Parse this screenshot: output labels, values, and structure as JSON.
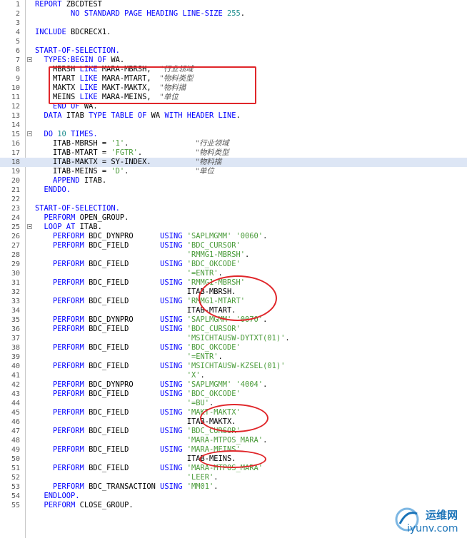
{
  "editor": {
    "highlight_line": 18,
    "fold_lines": [
      7,
      15,
      25
    ],
    "lines": [
      {
        "n": "1",
        "tokens": [
          [
            "kw",
            "REPORT "
          ],
          [
            "id",
            "ZBCDTEST"
          ]
        ]
      },
      {
        "n": "2",
        "tokens": [
          [
            "kw",
            "        NO STANDARD PAGE HEADING LINE-SIZE "
          ],
          [
            "num",
            "255"
          ],
          [
            "id",
            "."
          ]
        ]
      },
      {
        "n": "3",
        "tokens": []
      },
      {
        "n": "4",
        "tokens": [
          [
            "kw",
            "INCLUDE "
          ],
          [
            "id",
            "BDCRECX1."
          ]
        ]
      },
      {
        "n": "5",
        "tokens": []
      },
      {
        "n": "6",
        "tokens": [
          [
            "kw",
            "START-OF-SELECTION."
          ]
        ]
      },
      {
        "n": "7",
        "tokens": [
          [
            "kw",
            "  TYPES:BEGIN OF "
          ],
          [
            "id",
            "WA."
          ]
        ]
      },
      {
        "n": "8",
        "tokens": [
          [
            "id",
            "    MBRSH "
          ],
          [
            "kw",
            "LIKE "
          ],
          [
            "id",
            "MARA-MBRSH,  "
          ],
          [
            "cmt",
            "\"行业领域"
          ]
        ]
      },
      {
        "n": "9",
        "tokens": [
          [
            "id",
            "    MTART "
          ],
          [
            "kw",
            "LIKE "
          ],
          [
            "id",
            "MARA-MTART,  "
          ],
          [
            "cmt",
            "\"物料类型"
          ]
        ]
      },
      {
        "n": "10",
        "tokens": [
          [
            "id",
            "    MAKTX "
          ],
          [
            "kw",
            "LIKE "
          ],
          [
            "id",
            "MAKT-MAKTX,  "
          ],
          [
            "cmt",
            "\"物料描"
          ]
        ]
      },
      {
        "n": "11",
        "tokens": [
          [
            "id",
            "    MEINS "
          ],
          [
            "kw",
            "LIKE "
          ],
          [
            "id",
            "MARA-MEINS,  "
          ],
          [
            "cmt",
            "\"单位"
          ]
        ]
      },
      {
        "n": "12",
        "tokens": [
          [
            "kw",
            "    END OF "
          ],
          [
            "id",
            "WA."
          ]
        ]
      },
      {
        "n": "13",
        "tokens": [
          [
            "kw",
            "  DATA "
          ],
          [
            "id",
            "ITAB "
          ],
          [
            "kw",
            "TYPE TABLE OF "
          ],
          [
            "id",
            "WA "
          ],
          [
            "kw",
            "WITH HEADER LINE"
          ],
          [
            "id",
            "."
          ]
        ]
      },
      {
        "n": "14",
        "tokens": []
      },
      {
        "n": "15",
        "tokens": [
          [
            "kw",
            "  DO "
          ],
          [
            "num",
            "10"
          ],
          [
            "kw",
            " TIMES."
          ]
        ]
      },
      {
        "n": "16",
        "tokens": [
          [
            "id",
            "    ITAB-MBRSH = "
          ],
          [
            "str",
            "'1'"
          ],
          [
            "id",
            "."
          ],
          [
            "id",
            "               "
          ],
          [
            "cmt",
            "\"行业领域"
          ]
        ]
      },
      {
        "n": "17",
        "tokens": [
          [
            "id",
            "    ITAB-MTART = "
          ],
          [
            "str",
            "'FGTR'"
          ],
          [
            "id",
            "."
          ],
          [
            "id",
            "            "
          ],
          [
            "cmt",
            "\"物料类型"
          ]
        ]
      },
      {
        "n": "18",
        "tokens": [
          [
            "id",
            "    ITAB-MAKTX = SY-INDEX."
          ],
          [
            "id",
            "          "
          ],
          [
            "cmt",
            "\"物料描"
          ]
        ]
      },
      {
        "n": "19",
        "tokens": [
          [
            "id",
            "    ITAB-MEINS = "
          ],
          [
            "str",
            "'D'"
          ],
          [
            "id",
            "."
          ],
          [
            "id",
            "               "
          ],
          [
            "cmt",
            "\"单位"
          ]
        ]
      },
      {
        "n": "20",
        "tokens": [
          [
            "kw",
            "    APPEND "
          ],
          [
            "id",
            "ITAB."
          ]
        ]
      },
      {
        "n": "21",
        "tokens": [
          [
            "kw",
            "  ENDDO."
          ]
        ]
      },
      {
        "n": "22",
        "tokens": []
      },
      {
        "n": "23",
        "tokens": [
          [
            "kw",
            "START-OF-SELECTION."
          ]
        ]
      },
      {
        "n": "24",
        "tokens": [
          [
            "kw",
            "  PERFORM "
          ],
          [
            "id",
            "OPEN_GROUP."
          ]
        ]
      },
      {
        "n": "25",
        "tokens": [
          [
            "kw",
            "  LOOP AT "
          ],
          [
            "id",
            "ITAB."
          ]
        ]
      },
      {
        "n": "26",
        "tokens": [
          [
            "kw",
            "    PERFORM "
          ],
          [
            "id",
            "BDC_DYNPRO      "
          ],
          [
            "kw",
            "USING "
          ],
          [
            "str",
            "'SAPLMGMM' '0060'"
          ],
          [
            "id",
            "."
          ]
        ]
      },
      {
        "n": "27",
        "tokens": [
          [
            "kw",
            "    PERFORM "
          ],
          [
            "id",
            "BDC_FIELD       "
          ],
          [
            "kw",
            "USING "
          ],
          [
            "str",
            "'BDC_CURSOR'"
          ]
        ]
      },
      {
        "n": "28",
        "tokens": [
          [
            "id",
            "                                  "
          ],
          [
            "str",
            "'RMMG1-MBRSH'"
          ],
          [
            "id",
            "."
          ]
        ]
      },
      {
        "n": "29",
        "tokens": [
          [
            "kw",
            "    PERFORM "
          ],
          [
            "id",
            "BDC_FIELD       "
          ],
          [
            "kw",
            "USING "
          ],
          [
            "str",
            "'BDC_OKCODE'"
          ]
        ]
      },
      {
        "n": "30",
        "tokens": [
          [
            "id",
            "                                  "
          ],
          [
            "str",
            "'=ENTR'"
          ],
          [
            "id",
            "."
          ]
        ]
      },
      {
        "n": "31",
        "tokens": [
          [
            "kw",
            "    PERFORM "
          ],
          [
            "id",
            "BDC_FIELD       "
          ],
          [
            "kw",
            "USING "
          ],
          [
            "str",
            "'RMMG1-MBRSH'"
          ]
        ]
      },
      {
        "n": "32",
        "tokens": [
          [
            "id",
            "                                  ITAB-MBRSH."
          ]
        ]
      },
      {
        "n": "33",
        "tokens": [
          [
            "kw",
            "    PERFORM "
          ],
          [
            "id",
            "BDC_FIELD       "
          ],
          [
            "kw",
            "USING "
          ],
          [
            "str",
            "'RMMG1-MTART'"
          ]
        ]
      },
      {
        "n": "34",
        "tokens": [
          [
            "id",
            "                                  ITAB-MTART."
          ]
        ]
      },
      {
        "n": "35",
        "tokens": [
          [
            "kw",
            "    PERFORM "
          ],
          [
            "id",
            "BDC_DYNPRO      "
          ],
          [
            "kw",
            "USING "
          ],
          [
            "str",
            "'SAPLMGMM' '0070'"
          ],
          [
            "id",
            "."
          ]
        ]
      },
      {
        "n": "36",
        "tokens": [
          [
            "kw",
            "    PERFORM "
          ],
          [
            "id",
            "BDC_FIELD       "
          ],
          [
            "kw",
            "USING "
          ],
          [
            "str",
            "'BDC_CURSOR'"
          ]
        ]
      },
      {
        "n": "37",
        "tokens": [
          [
            "id",
            "                                  "
          ],
          [
            "str",
            "'MSICHTAUSW-DYTXT(01)'"
          ],
          [
            "id",
            "."
          ]
        ]
      },
      {
        "n": "38",
        "tokens": [
          [
            "kw",
            "    PERFORM "
          ],
          [
            "id",
            "BDC_FIELD       "
          ],
          [
            "kw",
            "USING "
          ],
          [
            "str",
            "'BDC_OKCODE'"
          ]
        ]
      },
      {
        "n": "39",
        "tokens": [
          [
            "id",
            "                                  "
          ],
          [
            "str",
            "'=ENTR'"
          ],
          [
            "id",
            "."
          ]
        ]
      },
      {
        "n": "40",
        "tokens": [
          [
            "kw",
            "    PERFORM "
          ],
          [
            "id",
            "BDC_FIELD       "
          ],
          [
            "kw",
            "USING "
          ],
          [
            "str",
            "'MSICHTAUSW-KZSEL(01)'"
          ]
        ]
      },
      {
        "n": "41",
        "tokens": [
          [
            "id",
            "                                  "
          ],
          [
            "str",
            "'X'"
          ],
          [
            "id",
            "."
          ]
        ]
      },
      {
        "n": "42",
        "tokens": [
          [
            "kw",
            "    PERFORM "
          ],
          [
            "id",
            "BDC_DYNPRO      "
          ],
          [
            "kw",
            "USING "
          ],
          [
            "str",
            "'SAPLMGMM' '4004'"
          ],
          [
            "id",
            "."
          ]
        ]
      },
      {
        "n": "43",
        "tokens": [
          [
            "kw",
            "    PERFORM "
          ],
          [
            "id",
            "BDC_FIELD       "
          ],
          [
            "kw",
            "USING "
          ],
          [
            "str",
            "'BDC_OKCODE'"
          ]
        ]
      },
      {
        "n": "44",
        "tokens": [
          [
            "id",
            "                                  "
          ],
          [
            "str",
            "'=BU'"
          ],
          [
            "id",
            "."
          ]
        ]
      },
      {
        "n": "45",
        "tokens": [
          [
            "kw",
            "    PERFORM "
          ],
          [
            "id",
            "BDC_FIELD       "
          ],
          [
            "kw",
            "USING "
          ],
          [
            "str",
            "'MAKT-MAKTX'"
          ]
        ]
      },
      {
        "n": "46",
        "tokens": [
          [
            "id",
            "                                  ITAB-MAKTX."
          ]
        ]
      },
      {
        "n": "47",
        "tokens": [
          [
            "kw",
            "    PERFORM "
          ],
          [
            "id",
            "BDC_FIELD       "
          ],
          [
            "kw",
            "USING "
          ],
          [
            "str",
            "'BDC_CURSOR'"
          ]
        ]
      },
      {
        "n": "48",
        "tokens": [
          [
            "id",
            "                                  "
          ],
          [
            "str",
            "'MARA-MTPOS_MARA'"
          ],
          [
            "id",
            "."
          ]
        ]
      },
      {
        "n": "49",
        "tokens": [
          [
            "kw",
            "    PERFORM "
          ],
          [
            "id",
            "BDC_FIELD       "
          ],
          [
            "kw",
            "USING "
          ],
          [
            "str",
            "'MARA-MEINS'"
          ]
        ]
      },
      {
        "n": "50",
        "tokens": [
          [
            "id",
            "                                  ITAB-MEINS."
          ]
        ]
      },
      {
        "n": "51",
        "tokens": [
          [
            "kw",
            "    PERFORM "
          ],
          [
            "id",
            "BDC_FIELD       "
          ],
          [
            "kw",
            "USING "
          ],
          [
            "str",
            "'MARA-MTPOS_MARA'"
          ]
        ]
      },
      {
        "n": "52",
        "tokens": [
          [
            "id",
            "                                  "
          ],
          [
            "str",
            "'LEER'"
          ],
          [
            "id",
            "."
          ]
        ]
      },
      {
        "n": "53",
        "tokens": [
          [
            "kw",
            "    PERFORM "
          ],
          [
            "id",
            "BDC_TRANSACTION "
          ],
          [
            "kw",
            "USING "
          ],
          [
            "str",
            "'MM01'"
          ],
          [
            "id",
            "."
          ]
        ]
      },
      {
        "n": "54",
        "tokens": [
          [
            "kw",
            "  ENDLOOP."
          ]
        ]
      },
      {
        "n": "55",
        "tokens": [
          [
            "kw",
            "  PERFORM "
          ],
          [
            "id",
            "CLOSE_GROUP."
          ]
        ]
      }
    ]
  },
  "colors": {
    "keyword": "#0000ff",
    "string": "#4a9b3a",
    "number": "#1e8e8e",
    "comment": "#555555",
    "annotation": "#e0262a",
    "highlight": "#dde6f5"
  },
  "watermark": {
    "line1": "运维网",
    "line2": "iyunv.com"
  }
}
